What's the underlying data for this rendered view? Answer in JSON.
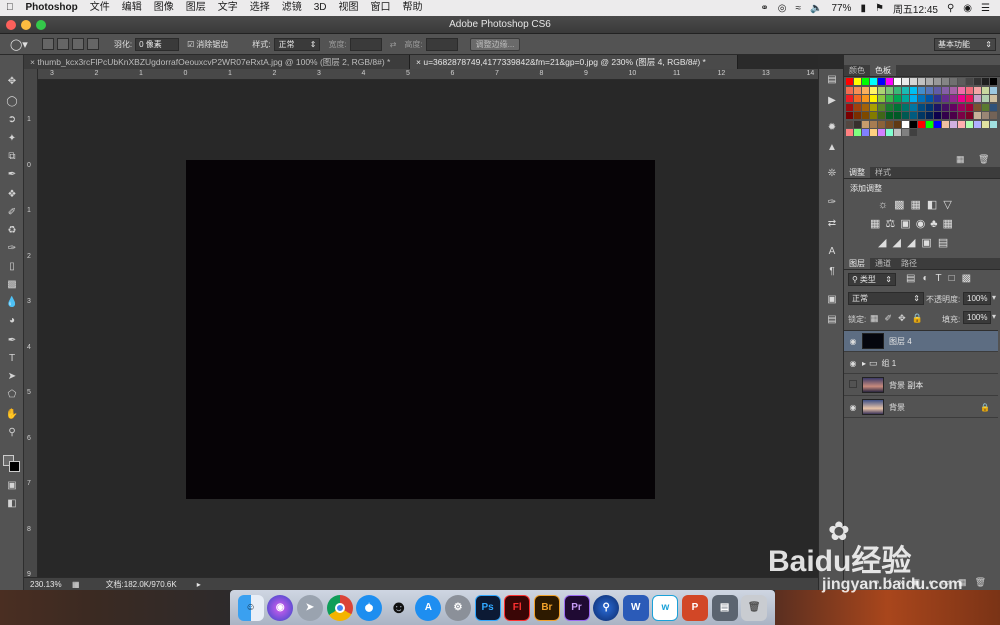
{
  "menubar": {
    "app_name": "Photoshop",
    "items": [
      "文件",
      "编辑",
      "图像",
      "图层",
      "文字",
      "选择",
      "滤镜",
      "3D",
      "视图",
      "窗口",
      "帮助"
    ],
    "battery": "77%",
    "clock": "周五12:45"
  },
  "window": {
    "title": "Adobe Photoshop CS6"
  },
  "options": {
    "feather_label": "羽化:",
    "feather_value": "0 像素",
    "antialias_label": "消除锯齿",
    "style_label": "样式:",
    "style_value": "正常",
    "width_label": "宽度:",
    "height_label": "高度:",
    "refine_edge_button": "调整边缘...",
    "workspace": "基本功能"
  },
  "tabs": [
    {
      "label": "thumb_kcx3rcFlPcUbKnXBZUgdorrafOeouxcvP2WR07eRxtA.jpg @ 100% (图层 2, RGB/8#) *"
    },
    {
      "label": "u=3682878749,4177339842&fm=21&gp=0.jpg @ 230% (图层 4, RGB/8#) *"
    }
  ],
  "rulers": {
    "horizontal": [
      "3",
      "2",
      "1",
      "0",
      "1",
      "2",
      "3",
      "4",
      "5",
      "6",
      "7",
      "8",
      "9",
      "10",
      "11",
      "12",
      "13",
      "14"
    ],
    "vertical": [
      "1",
      "0",
      "1",
      "2",
      "3",
      "4",
      "5",
      "6",
      "7",
      "8",
      "9"
    ]
  },
  "status": {
    "zoom": "230.13%",
    "doc": "文档:182.0K/970.6K"
  },
  "swatches_panel": {
    "tabs": [
      "颜色",
      "色板"
    ]
  },
  "adjustments_panel": {
    "tabs": [
      "调整",
      "样式"
    ],
    "heading": "添加调整"
  },
  "layers_panel": {
    "tabs": [
      "图层",
      "通道",
      "路径"
    ],
    "filter_kind": "类型",
    "blend_mode": "正常",
    "opacity_label": "不透明度:",
    "opacity_value": "100%",
    "lock_label": "锁定:",
    "fill_label": "填充:",
    "fill_value": "100%",
    "layers": [
      {
        "name": "图层 4",
        "visible": true,
        "selected": true
      },
      {
        "name": "组 1",
        "visible": true,
        "selected": false
      },
      {
        "name": "背景 副本",
        "visible": false,
        "selected": false
      },
      {
        "name": "背景",
        "visible": true,
        "selected": false
      }
    ]
  },
  "dock": {
    "apps": [
      "finder",
      "siri",
      "launchpad",
      "chrome",
      "safari",
      "qq",
      "app-store",
      "system-preferences",
      "Ps",
      "Fl",
      "Br",
      "Pr",
      "quicktime",
      "W",
      "wiz",
      "P",
      "screenshot",
      "trash"
    ],
    "labels": {
      "ps": "Ps",
      "fl": "Fl",
      "br": "Br",
      "pr": "Pr"
    }
  },
  "watermark": {
    "brand": "Baidu经验",
    "url": "jingyan.baidu.com"
  }
}
